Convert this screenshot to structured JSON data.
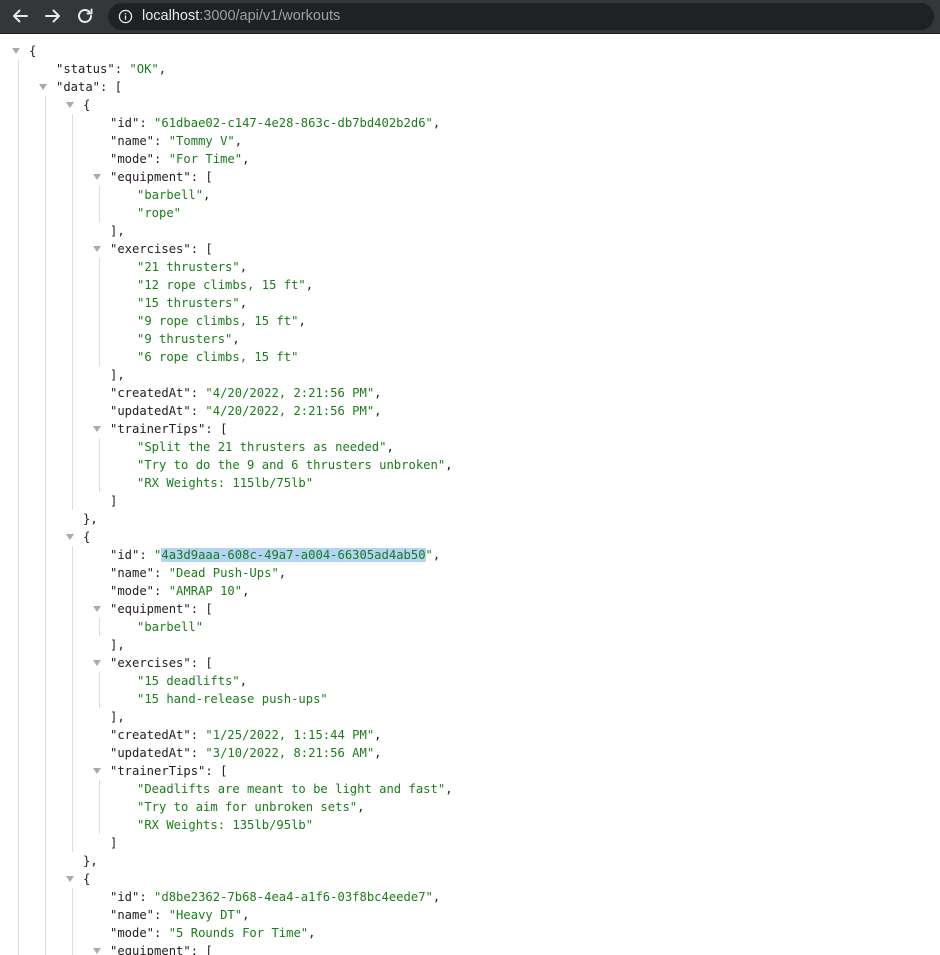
{
  "browser": {
    "url_host": "localhost",
    "url_rest": ":3000/api/v1/workouts"
  },
  "json": {
    "status_key": "\"status\"",
    "status_value": "\"OK\"",
    "data_key": "\"data\"",
    "workouts": [
      {
        "id": "\"61dbae02-c147-4e28-863c-db7bd402b2d6\"",
        "name": "\"Tommy V\"",
        "mode": "\"For Time\"",
        "equipment": [
          "\"barbell\"",
          "\"rope\""
        ],
        "exercises": [
          "\"21 thrusters\"",
          "\"12 rope climbs, 15 ft\"",
          "\"15 thrusters\"",
          "\"9 rope climbs, 15 ft\"",
          "\"9 thrusters\"",
          "\"6 rope climbs, 15 ft\""
        ],
        "createdAt": "\"4/20/2022, 2:21:56 PM\"",
        "updatedAt": "\"4/20/2022, 2:21:56 PM\"",
        "trainerTips": [
          "\"Split the 21 thrusters as needed\"",
          "\"Try to do the 9 and 6 thrusters unbroken\"",
          "\"RX Weights: 115lb/75lb\""
        ]
      },
      {
        "id_selected": "4a3d9aaa-608c-49a7-a004-66305ad4ab50",
        "name": "\"Dead Push-Ups\"",
        "mode": "\"AMRAP 10\"",
        "equipment": [
          "\"barbell\""
        ],
        "exercises": [
          "\"15 deadlifts\"",
          "\"15 hand-release push-ups\""
        ],
        "createdAt": "\"1/25/2022, 1:15:44 PM\"",
        "updatedAt": "\"3/10/2022, 8:21:56 AM\"",
        "trainerTips": [
          "\"Deadlifts are meant to be light and fast\"",
          "\"Try to aim for unbroken sets\"",
          "\"RX Weights: 135lb/95lb\""
        ]
      },
      {
        "id": "\"d8be2362-7b68-4ea4-a1f6-03f8bc4eede7\"",
        "name": "\"Heavy DT\"",
        "mode": "\"5 Rounds For Time\""
      }
    ],
    "keys": {
      "id": "\"id\"",
      "name": "\"name\"",
      "mode": "\"mode\"",
      "equipment": "\"equipment\"",
      "exercises": "\"exercises\"",
      "createdAt": "\"createdAt\"",
      "updatedAt": "\"updatedAt\"",
      "trainerTips": "\"trainerTips\""
    }
  }
}
